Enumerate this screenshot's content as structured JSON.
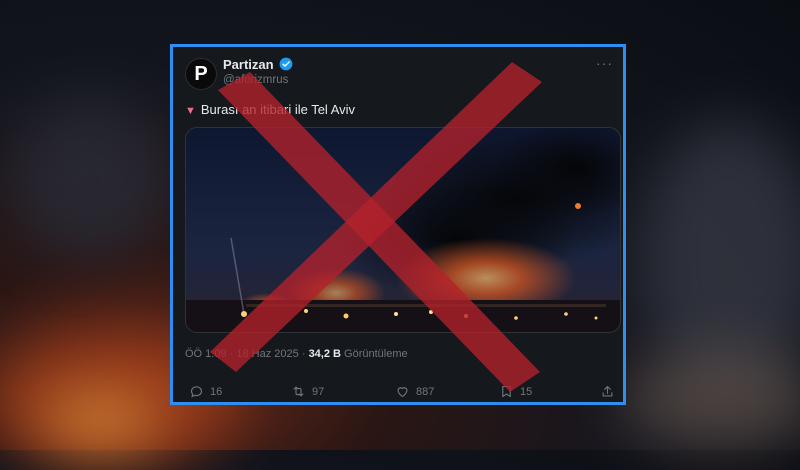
{
  "tweet": {
    "avatar_letter": "P",
    "display_name": "Partizan",
    "handle": "@aforizmrus",
    "more_symbol": "···",
    "marker_symbol": "▼",
    "text": "Burası an itibari ile Tel Aviv",
    "time": "ÖÖ 1:09",
    "separator": "·",
    "date": "18 Haz 2025",
    "views_value": "34,2 B",
    "views_label": "Görüntüleme"
  },
  "actions": {
    "replies": "16",
    "retweets": "97",
    "likes": "887",
    "bookmarks": "15"
  },
  "colors": {
    "frame": "#2f8ef2",
    "cross": "#b3212b",
    "verified": "#1d9bf0"
  },
  "icons": [
    "verified-badge-icon",
    "more-icon",
    "reply-icon",
    "retweet-icon",
    "like-icon",
    "bookmark-icon",
    "share-icon"
  ]
}
